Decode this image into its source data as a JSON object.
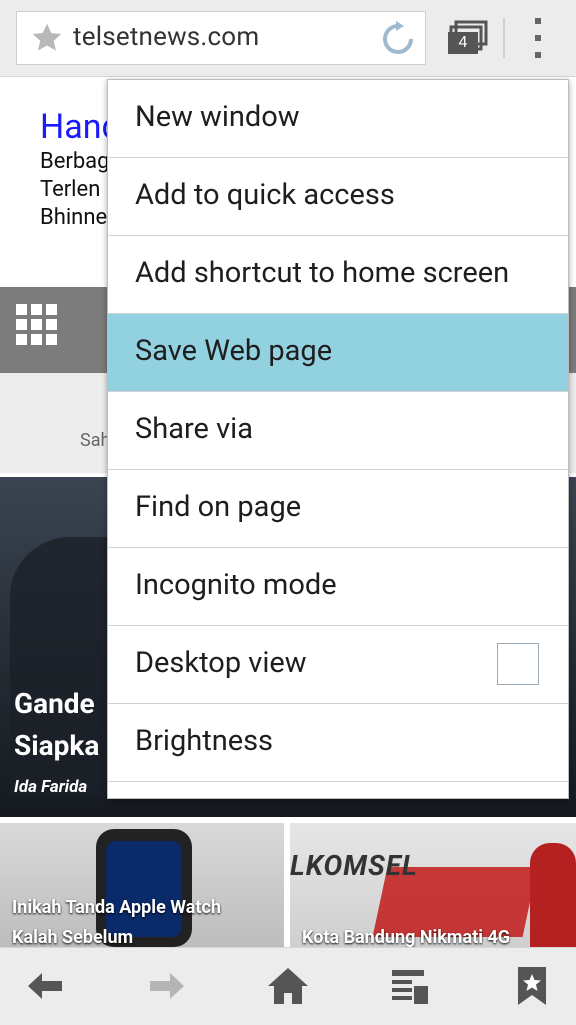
{
  "browser": {
    "url": "telsetnews.com",
    "tab_count": "4"
  },
  "page": {
    "ad_title": "Hand",
    "ad_lines": [
      "Berbag",
      "Terlen",
      "Bhinne"
    ],
    "sah": "Sah",
    "hero_title_lines": [
      "Gande",
      "Siapka"
    ],
    "hero_author": "Ida Farida",
    "thumb1_caption_lines": [
      "Inikah Tanda Apple Watch",
      "Kalah Sebelum"
    ],
    "thumb2_brand": "LKOMSEL",
    "thumb2_caption": "Kota Bandung Nikmati 4G"
  },
  "menu": {
    "items": [
      {
        "label": "New window"
      },
      {
        "label": "Add to quick access"
      },
      {
        "label": "Add shortcut to home screen"
      },
      {
        "label": "Save Web page"
      },
      {
        "label": "Share via"
      },
      {
        "label": "Find on page"
      },
      {
        "label": "Incognito mode"
      },
      {
        "label": "Desktop view"
      },
      {
        "label": "Brightness"
      }
    ],
    "selected_item": "Save Web page",
    "desktop_view_checked": false
  },
  "bottom_nav": [
    "back-icon",
    "forward-icon",
    "home-icon",
    "reading-list-icon",
    "bookmarks-icon"
  ],
  "colors": {
    "selected_highlight": "#92d1df",
    "toolbar": "#ececec",
    "ad_link": "#1a1aff"
  }
}
